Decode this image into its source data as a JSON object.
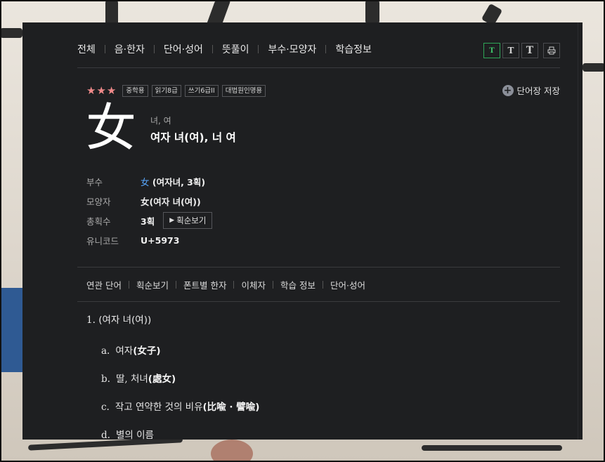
{
  "top_nav": [
    "전체",
    "음·한자",
    "단어·성어",
    "뜻풀이",
    "부수·모양자",
    "학습정보"
  ],
  "font_buttons": [
    "T",
    "T",
    "T"
  ],
  "print_icon": "print-icon",
  "stars": "★★★",
  "tags": [
    "중학용",
    "읽기8급",
    "쓰기6급II",
    "대법원인명용"
  ],
  "save_label": "단어장 저장",
  "hanja": "女",
  "reading_small": "녀, 여",
  "reading_main": "여자 녀(여), 너 여",
  "info": {
    "radical_label": "부수",
    "radical_char": "女",
    "radical_desc": " (여자녀, 3획)",
    "shape_label": "모양자",
    "shape_value": "女(여자 녀(여))",
    "strokes_label": "총획수",
    "strokes_value": "3획",
    "stroke_button": "획순보기",
    "unicode_label": "유니코드",
    "unicode_value": "U+5973"
  },
  "sub_nav": [
    "연관 단어",
    "획순보기",
    "폰트별 한자",
    "이체자",
    "학습 정보",
    "단어·성어"
  ],
  "meaning": {
    "number": "1.",
    "title": "(여자 녀(여))",
    "items": [
      {
        "letter": "a.",
        "text": "여자",
        "han": "(女子)"
      },
      {
        "letter": "b.",
        "text": "딸, 처녀",
        "han": "(處女)"
      },
      {
        "letter": "c.",
        "text": "작고 연약한 것의 비유",
        "han": "(比喩 · 譬喩)"
      },
      {
        "letter": "d.",
        "text": "별의 이름",
        "han": ""
      }
    ]
  }
}
